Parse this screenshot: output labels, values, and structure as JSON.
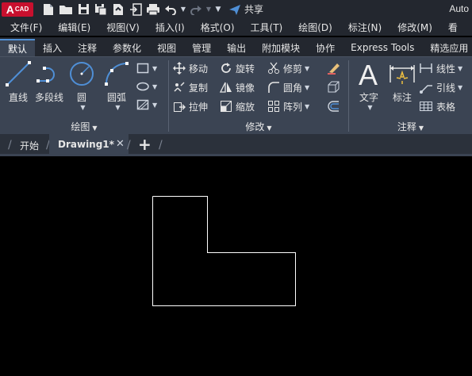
{
  "app": {
    "logo_text": "A",
    "logo_small": "CAD",
    "share_label": "共享",
    "window_title": "Auto"
  },
  "menu": [
    "文件(F)",
    "编辑(E)",
    "视图(V)",
    "插入(I)",
    "格式(O)",
    "工具(T)",
    "绘图(D)",
    "标注(N)",
    "修改(M)",
    "看"
  ],
  "ribbon_tabs": [
    "默认",
    "插入",
    "注释",
    "参数化",
    "视图",
    "管理",
    "输出",
    "附加模块",
    "协作",
    "Express Tools",
    "精选应用"
  ],
  "draw_panel": {
    "label": "绘图",
    "tools": {
      "line": "直线",
      "polyline": "多段线",
      "circle": "圆",
      "arc": "圆弧"
    }
  },
  "modify_panel": {
    "label": "修改",
    "tools": {
      "move": "移动",
      "rotate": "旋转",
      "trim": "修剪",
      "copy": "复制",
      "mirror": "镜像",
      "fillet": "圆角",
      "stretch": "拉伸",
      "scale": "缩放",
      "array": "阵列"
    }
  },
  "annotation_panel": {
    "label": "注释",
    "tools": {
      "text": "文字",
      "dimension": "标注",
      "linear": "线性",
      "leader": "引线",
      "table": "表格"
    }
  },
  "doc_tabs": {
    "start": "开始",
    "drawing": "Drawing1*"
  },
  "colors": {
    "ui_bg": "#23272f",
    "ribbon_bg": "#3b4453",
    "accent_blue": "#4f8fd6",
    "logo_red": "#c8102e",
    "canvas_bg": "#000000"
  }
}
